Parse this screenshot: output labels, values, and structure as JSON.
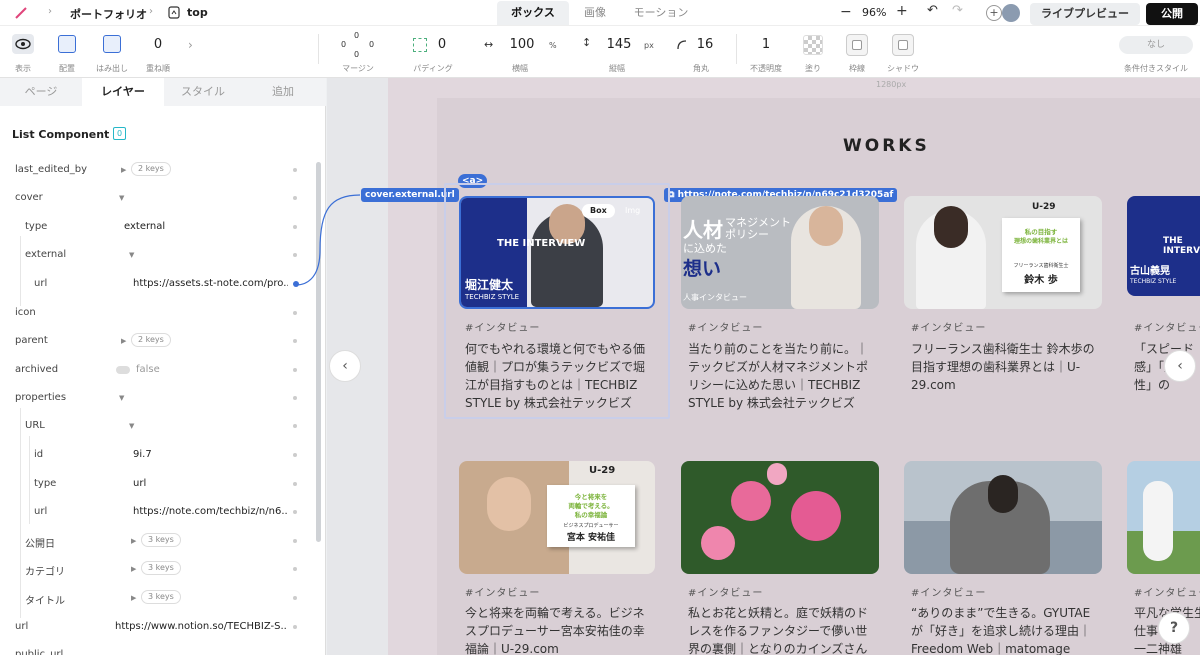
{
  "topbar": {
    "breadcrumb": [
      "ポートフォリオ",
      "top"
    ],
    "tabs": [
      "ボックス",
      "画像",
      "モーション"
    ],
    "zoom": "96%",
    "live_preview": "ライブプレビュー",
    "publish": "公開"
  },
  "toolbar": {
    "display": "表示",
    "placement": "配置",
    "overflow": "はみ出し",
    "zorder_value": "0",
    "zorder": "重ね順",
    "margin": "マージン",
    "margin_values": [
      "0",
      "0",
      "0",
      "0"
    ],
    "padding_value": "0",
    "padding": "パディング",
    "width_value": "100",
    "width_unit": "%",
    "width": "横幅",
    "height_value": "145",
    "height_unit": "px",
    "height": "縦幅",
    "radius_value": "16",
    "radius": "角丸",
    "opacity_value": "1",
    "opacity": "不透明度",
    "fill": "塗り",
    "border": "枠線",
    "shadow": "シャドウ",
    "conditional_value": "なし",
    "conditional": "条件付きスタイル"
  },
  "panel": {
    "tabs": [
      "ページ",
      "レイヤー",
      "スタイル",
      "追加"
    ],
    "title": "List Component",
    "title_badge": "0",
    "rows": [
      {
        "label": "last_edited_by",
        "pill": "2 keys"
      },
      {
        "label": "cover"
      },
      {
        "label": "type",
        "value": "external"
      },
      {
        "label": "external"
      },
      {
        "label": "url",
        "value": "https://assets.st-note.com/pro..."
      },
      {
        "label": "icon"
      },
      {
        "label": "parent",
        "pill": "2 keys"
      },
      {
        "label": "archived",
        "value": "false"
      },
      {
        "label": "properties"
      },
      {
        "label": "URL"
      },
      {
        "label": "id",
        "value": "9i.7"
      },
      {
        "label": "type",
        "value": "url"
      },
      {
        "label": "url",
        "value": "https://note.com/techbiz/n/n6..."
      },
      {
        "label": "公開日",
        "pill": "3 keys"
      },
      {
        "label": "カテゴリ",
        "pill": "3 keys"
      },
      {
        "label": "タイトル",
        "pill": "3 keys"
      },
      {
        "label": "url",
        "value": "https://www.notion.so/TECHBIZ-S..."
      },
      {
        "label": "public_url"
      }
    ]
  },
  "canvas": {
    "ruler_label": "1280px",
    "heading": "WORKS",
    "binding_chip": "cover.external.url",
    "anchor_chip": "<a>",
    "link_chip": "https://note.com/techbiz/n/n69c21d3205af",
    "box_toggle": [
      "Box",
      "Img"
    ],
    "help": "?",
    "cards": [
      {
        "tag": "#インタビュー",
        "title": "何でもやれる環境と何でもやる価値観｜プロが集うテックビズで堀江が目指すものとは｜TECHBIZ STYLE by 株式会社テックビズ",
        "img_text": [
          "THE INTERVIEW",
          "堀江健太",
          "TECHBIZ STYLE"
        ]
      },
      {
        "tag": "#インタビュー",
        "title": "当たり前のことを当たり前に。｜テックビズが人材マネジメントポリシーに込めた思い｜TECHBIZ STYLE by 株式会社テックビズ",
        "img_text": [
          "人材",
          "マネジメント",
          "ポリシー",
          "に込めた",
          "想い",
          "人事インタビュー"
        ]
      },
      {
        "tag": "#インタビュー",
        "title": "フリーランス歯科衛生士 鈴木歩の目指す理想の歯科業界とは｜U-29.com",
        "img_text": [
          "U-29",
          "私の目指す",
          "理想の歯科業界とは",
          "フリーランス歯科衛生士",
          "鈴木 歩"
        ]
      },
      {
        "tag": "#インタビュー",
        "title": "「スピード感」「柔軟性」の",
        "img_text": [
          "THE INTERVIEW",
          "古山義晃",
          "TECHBIZ STYLE"
        ]
      },
      {
        "tag": "#インタビュー",
        "title": "今と将来を両輪で考える。ビジネスプロデューサー宮本安祐佳の幸福論｜U-29.com",
        "img_text": [
          "U-29",
          "今と将来を",
          "両輪で考える。",
          "私の幸福論",
          "ビジネスプロデューサー",
          "宮本 安祐佳"
        ]
      },
      {
        "tag": "#インタビュー",
        "title": "私とお花と妖精と。庭で妖精のドレスを作るファンタジーで儚い世界の裏側｜となりのカインズさん",
        "img_text": []
      },
      {
        "tag": "#インタビュー",
        "title": "“ありのまま”で生きる。GYUTAEが「好き」を追求し続ける理由｜Freedom Web｜matomage",
        "img_text": []
      },
      {
        "tag": "#インタビュー",
        "title": "平凡な学生生活を",
        "title2": "仕事",
        "title3": "一二神雄",
        "img_text": []
      }
    ]
  }
}
